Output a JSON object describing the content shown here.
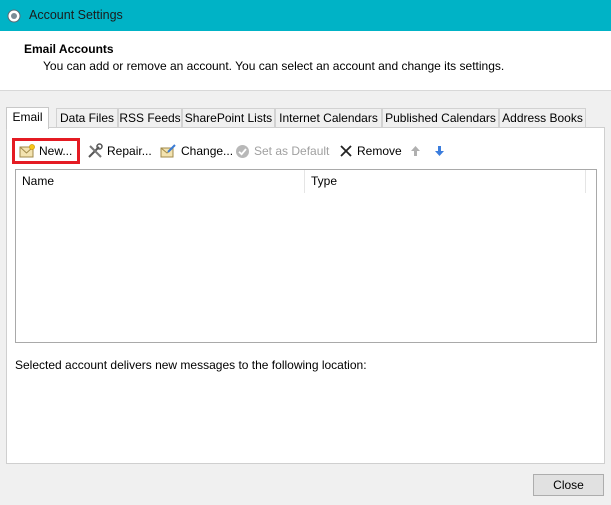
{
  "window": {
    "title": "Account Settings"
  },
  "header": {
    "title": "Email Accounts",
    "subtitle": "You can add or remove an account. You can select an account and change its settings."
  },
  "tabs": [
    {
      "label": "Email",
      "active": true
    },
    {
      "label": "Data Files",
      "active": false
    },
    {
      "label": "RSS Feeds",
      "active": false
    },
    {
      "label": "SharePoint Lists",
      "active": false
    },
    {
      "label": "Internet Calendars",
      "active": false
    },
    {
      "label": "Published Calendars",
      "active": false
    },
    {
      "label": "Address Books",
      "active": false
    }
  ],
  "toolbar": {
    "new_label": "New...",
    "repair_label": "Repair...",
    "change_label": "Change...",
    "set_default_label": "Set as Default",
    "remove_label": "Remove"
  },
  "list": {
    "columns": [
      "Name",
      "Type"
    ],
    "rows": []
  },
  "location_label": "Selected account delivers new messages to the following location:",
  "footer": {
    "close_label": "Close"
  },
  "colors": {
    "titlebar": "#00b3c6",
    "highlight": "#e41b23",
    "arrow": "#3b7ddd"
  }
}
